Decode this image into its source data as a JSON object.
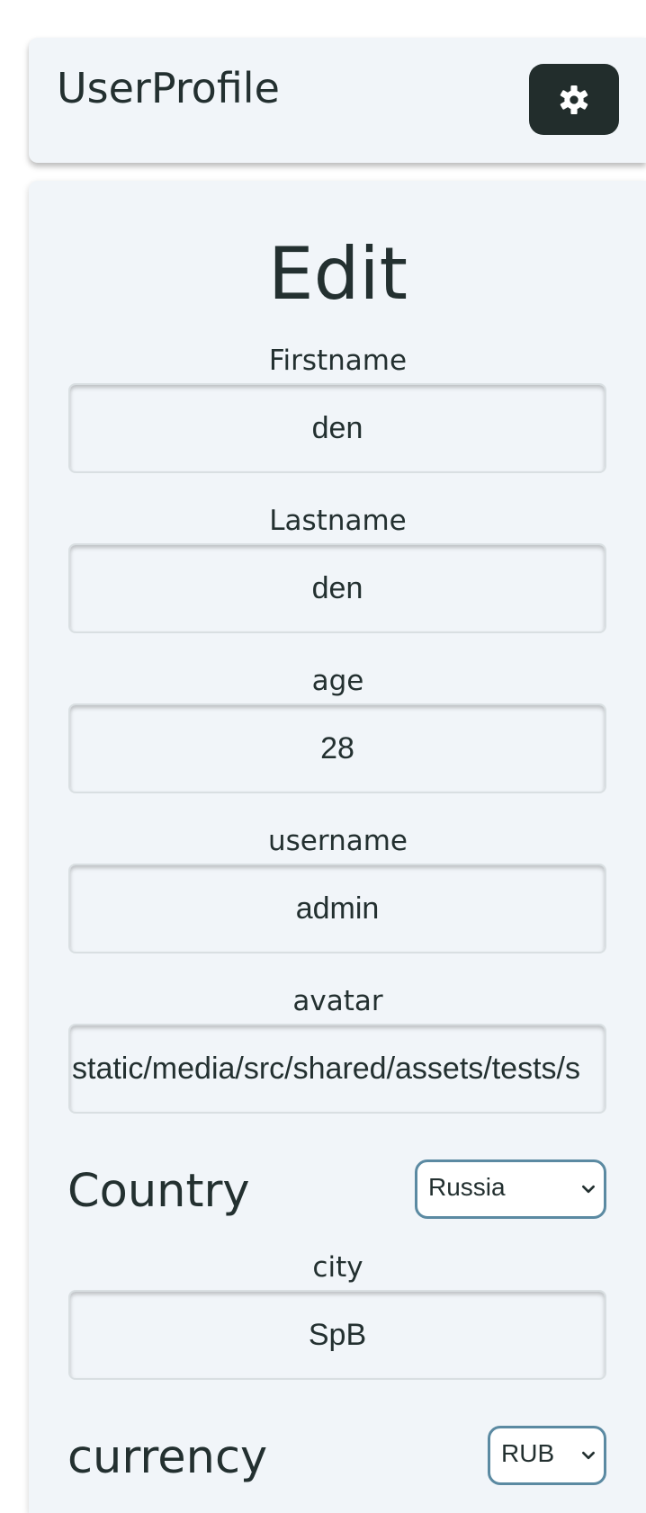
{
  "header": {
    "app_title": "UserProfile",
    "settings_icon": "gear-icon"
  },
  "form": {
    "title": "Edit",
    "fields": {
      "firstname": {
        "label": "Firstname",
        "value": "den"
      },
      "lastname": {
        "label": "Lastname",
        "value": "den"
      },
      "age": {
        "label": "age",
        "value": "28"
      },
      "username": {
        "label": "username",
        "value": "admin"
      },
      "avatar": {
        "label": "avatar",
        "value": "static/media/src/shared/assets/tests/s"
      },
      "city": {
        "label": "city",
        "value": "SpB"
      }
    },
    "country": {
      "label": "Country",
      "selected": "Russia"
    },
    "currency": {
      "label": "currency",
      "selected": "RUB"
    }
  },
  "colors": {
    "panel_background": "#f1f5f9",
    "button_background": "#222d2c",
    "select_border": "#5b8aa2",
    "text": "#233030"
  }
}
